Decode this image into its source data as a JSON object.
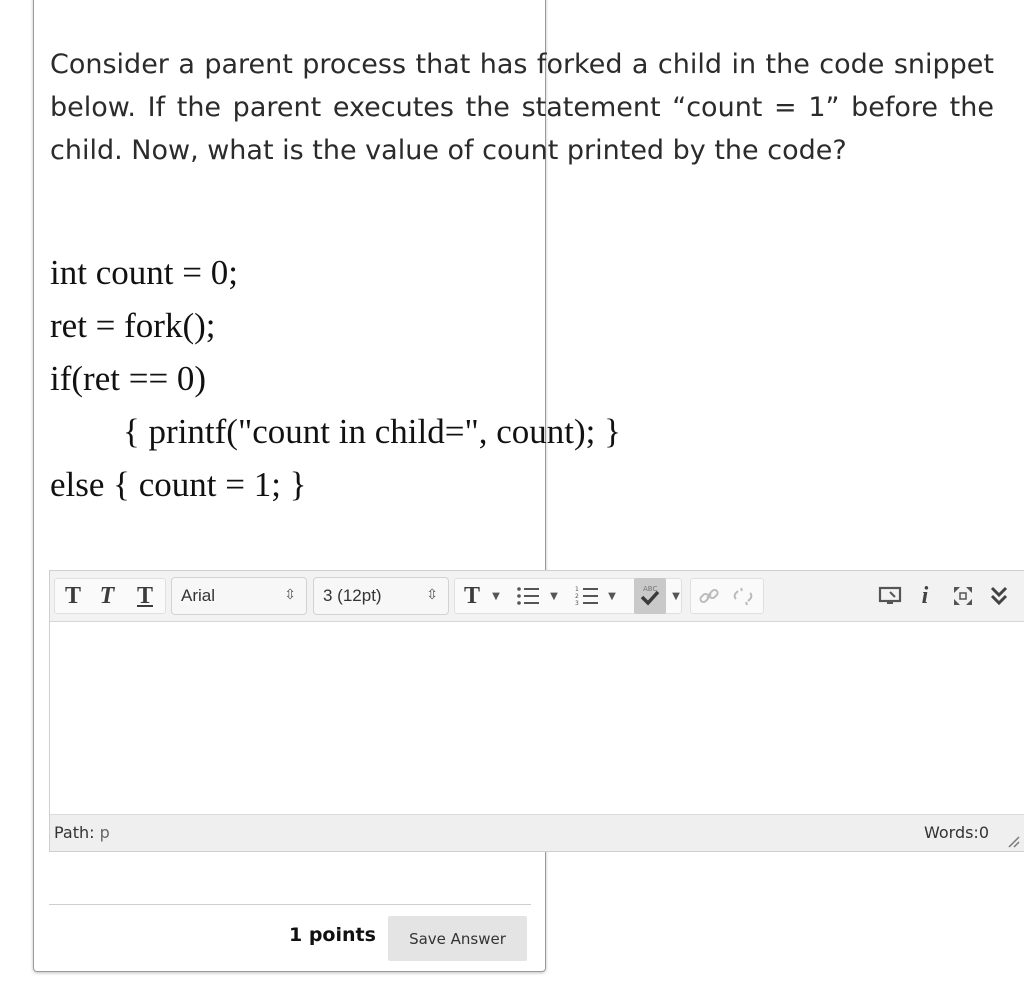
{
  "question": {
    "text": "Consider a parent process that has forked a child in the code snippet below. If the parent executes the statement “count = 1” before the child. Now, what is the value of count printed by the code?",
    "code_lines": [
      "int count = 0;",
      "ret = fork();",
      "if(ret == 0)",
      "{ printf(\"count in child=\", count); }",
      "else { count = 1; }"
    ]
  },
  "editor": {
    "font_family_value": "Arial",
    "font_size_value": "3 (12pt)",
    "path_label": "Path:",
    "path_value": "p",
    "word_count": "Words:0",
    "content": ""
  },
  "footer": {
    "points": "1 points",
    "save_label": "Save Answer"
  },
  "icons": {
    "bold": "bold-t-icon",
    "italic": "italic-t-icon",
    "underline": "underline-t-icon",
    "text_color": "text-color-icon",
    "bullet_list": "bullet-list-icon",
    "numbered_list": "numbered-list-icon",
    "spellcheck": "spellcheck-icon",
    "link": "link-icon",
    "unlink": "unlink-icon",
    "preview": "preview-monitor-icon",
    "info": "info-icon",
    "fullscreen": "fullscreen-icon",
    "collapse": "chevron-double-down-icon"
  }
}
